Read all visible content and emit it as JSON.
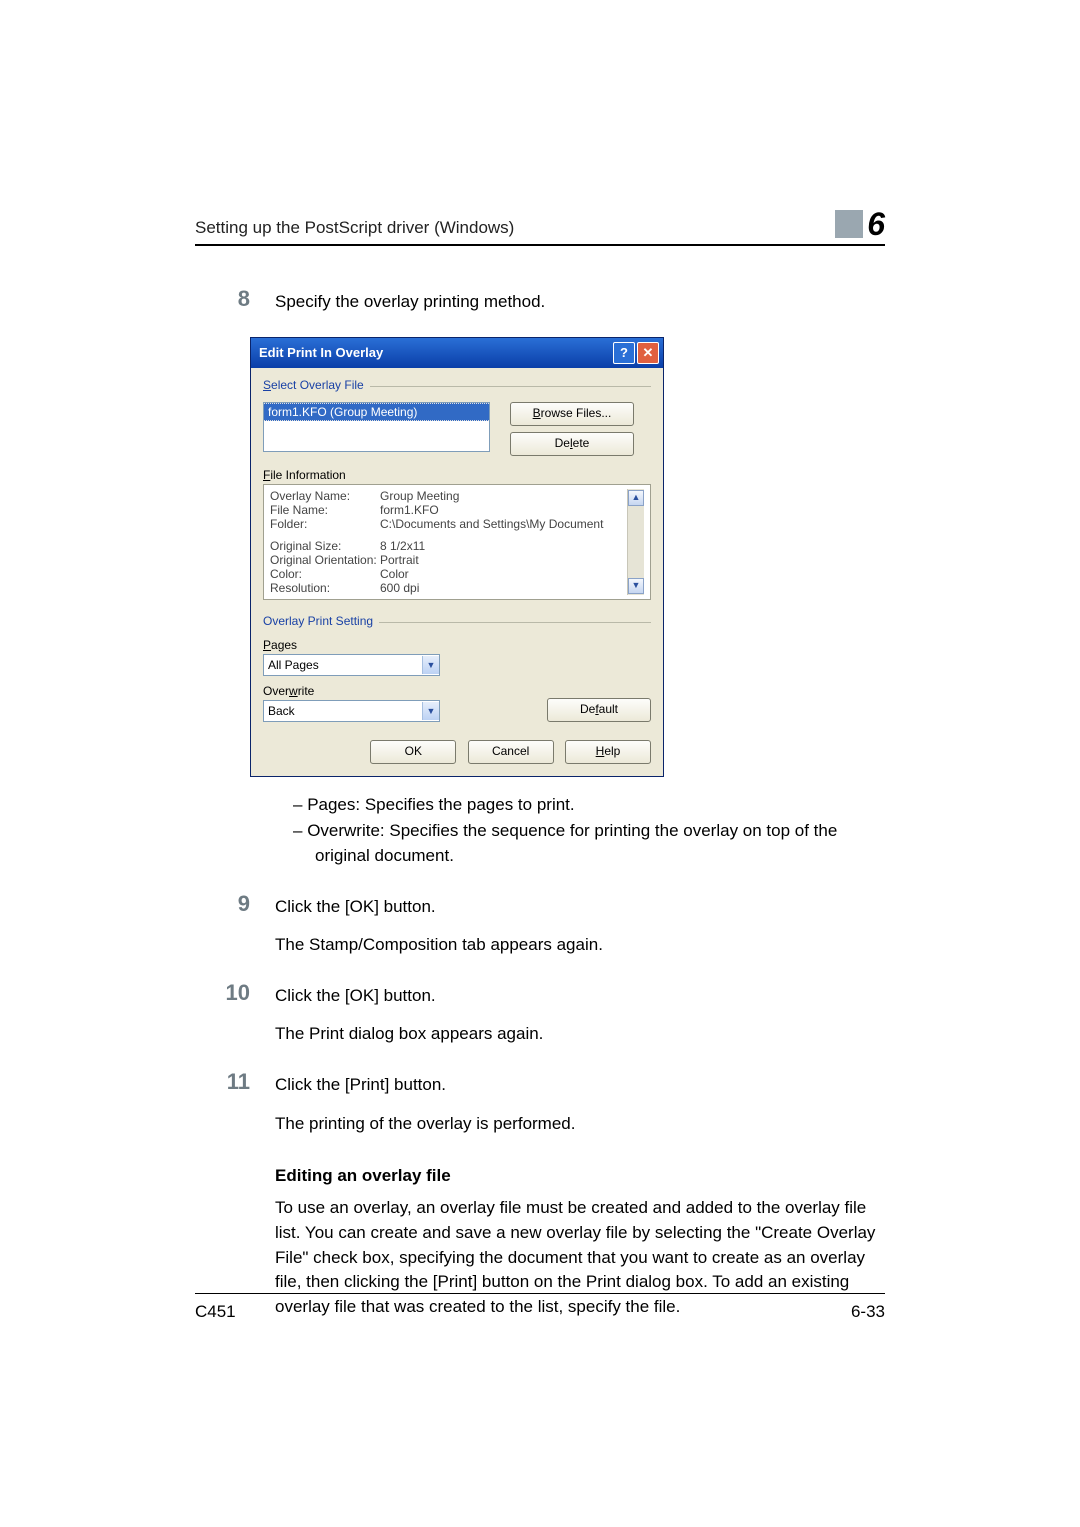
{
  "header": {
    "title": "Setting up the PostScript driver (Windows)",
    "chapter": "6"
  },
  "steps": {
    "s8_num": "8",
    "s8_text": "Specify the overlay printing method.",
    "bullet_pages": "Pages: Specifies the pages to print.",
    "bullet_overwrite": "Overwrite: Specifies the sequence for printing the overlay on top of the original document.",
    "s9_num": "9",
    "s9_text": "Click the [OK] button.",
    "s9_after": "The Stamp/Composition tab appears again.",
    "s10_num": "10",
    "s10_text": "Click the [OK] button.",
    "s10_after": "The Print dialog box appears again.",
    "s11_num": "11",
    "s11_text": "Click the [Print] button.",
    "s11_after": "The printing of the overlay is performed."
  },
  "section_heading": "Editing an overlay file",
  "section_body": "To use an overlay, an overlay file must be created and added to the overlay file list. You can create and save a new overlay file by selecting the \"Create Overlay File\" check box, specifying the document that you want to create as an overlay file, then clicking the [Print] button on the Print dialog box. To add an existing overlay file that was created to the list, specify the file.",
  "footer": {
    "left": "C451",
    "right": "6-33"
  },
  "dialog": {
    "title": "Edit Print In Overlay",
    "select_label": "Select Overlay File",
    "file_row": "form1.KFO (Group Meeting)",
    "browse": "Browse Files...",
    "delete": "Delete",
    "file_info_label": "File Information",
    "rows": {
      "r1k": "Overlay Name:",
      "r1v": "Group Meeting",
      "r2k": "File Name:",
      "r2v": "form1.KFO",
      "r3k": "Folder:",
      "r3v": "C:\\Documents and Settings\\My Document",
      "r4k": "Original Size:",
      "r4v": "8 1/2x11",
      "r5k": "Original Orientation:",
      "r5v": "Portrait",
      "r6k": "Color:",
      "r6v": "Color",
      "r7k": "Resolution:",
      "r7v": "600 dpi"
    },
    "ops_label": "Overlay Print Setting",
    "pages_label": "Pages",
    "pages_value": "All Pages",
    "overwrite_label": "Overwrite",
    "overwrite_value": "Back",
    "default": "Default",
    "ok": "OK",
    "cancel": "Cancel",
    "help": "Help"
  }
}
